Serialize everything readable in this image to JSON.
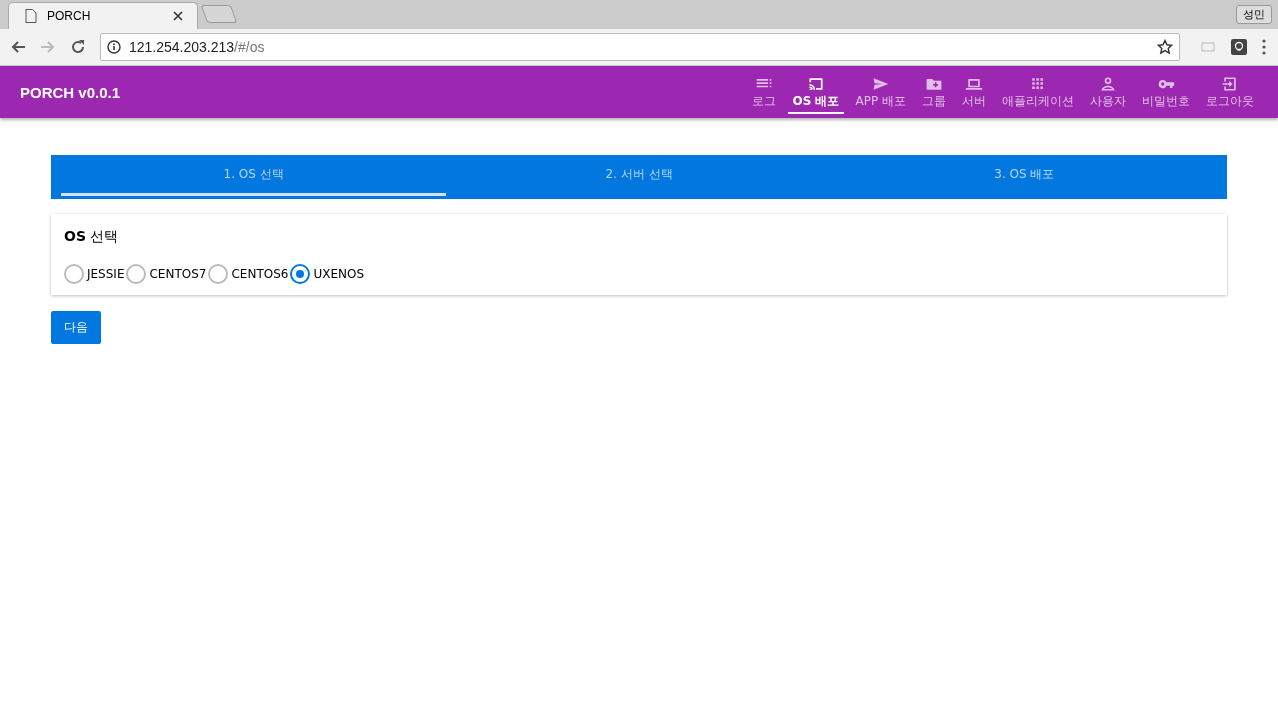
{
  "browser": {
    "tab_title": "PORCH",
    "profile": "성민",
    "url_host": "121.254.203.213",
    "url_path": "/#/os"
  },
  "app_bar": {
    "title": "PORCH v0.0.1",
    "nav": [
      {
        "label": "로그",
        "selected": false
      },
      {
        "label": "OS 배포",
        "selected": true
      },
      {
        "label": "APP 배포",
        "selected": false
      },
      {
        "label": "그룹",
        "selected": false
      },
      {
        "label": "서버",
        "selected": false
      },
      {
        "label": "애플리케이션",
        "selected": false
      },
      {
        "label": "사용자",
        "selected": false
      },
      {
        "label": "비밀번호",
        "selected": false
      },
      {
        "label": "로그아웃",
        "selected": false
      }
    ]
  },
  "steps": [
    {
      "label": "1. OS 선택",
      "selected": true
    },
    {
      "label": "2. 서버 선택",
      "selected": false
    },
    {
      "label": "3. OS 배포",
      "selected": false
    }
  ],
  "card": {
    "title": "**OS** 선택",
    "options": [
      {
        "label": "JESSIE",
        "selected": false
      },
      {
        "label": "CENTOS7",
        "selected": false
      },
      {
        "label": "CENTOS6",
        "selected": false
      },
      {
        "label": "UXENOS",
        "selected": true
      }
    ]
  },
  "next_button": "다음"
}
